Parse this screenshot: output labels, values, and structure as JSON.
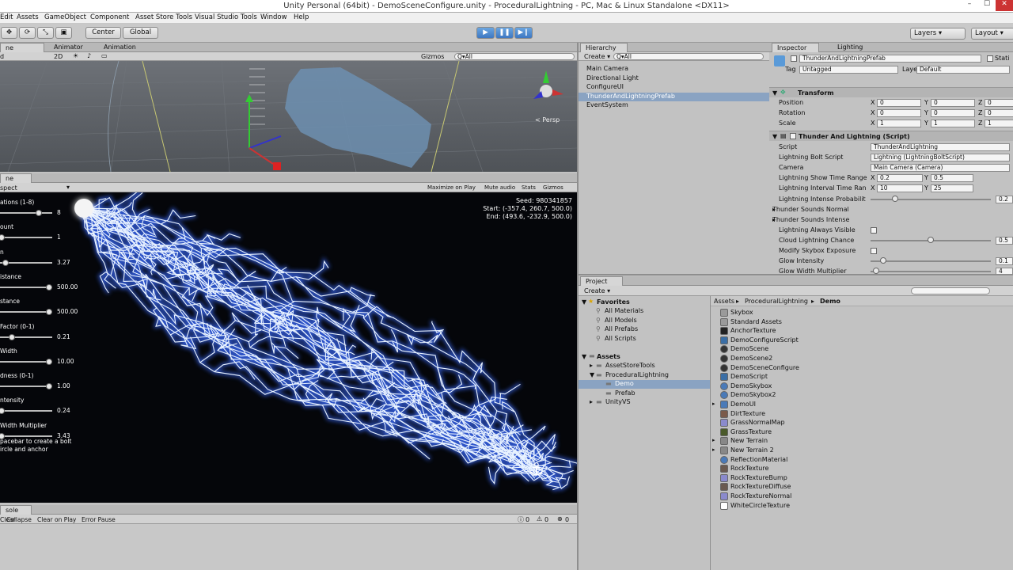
{
  "window": {
    "title": "Unity Personal (64bit) - DemoSceneConfigure.unity - ProceduralLightning - PC, Mac & Linux Standalone <DX11>",
    "min": "–",
    "max": "☐",
    "close": "✕"
  },
  "menu": [
    "Edit",
    "Assets",
    "GameObject",
    "Component",
    "Asset Store Tools",
    "Visual Studio Tools",
    "Window",
    "Help"
  ],
  "toolbar": {
    "center": "Center",
    "global": "Global",
    "layers": "Layers",
    "layout": "Layout"
  },
  "scene": {
    "tab": "ne",
    "animator": "Animator",
    "animation": "Animation",
    "mode": "d",
    "two_d": "2D",
    "gizmos": "Gizmos",
    "search": "Q▾All",
    "persp": "< Persp"
  },
  "game": {
    "tab": "ne",
    "aspect": "spect",
    "maximize": "Maximize on Play",
    "mute": "Mute audio",
    "stats": "Stats",
    "gizmos": "Gizmos",
    "seed": "Seed: 980341857",
    "start": "Start: (-357.4, 260.7, 500.0)",
    "end": "End: (493.6, -232.9, 500.0)",
    "controls": [
      {
        "label": "ations (1-8)",
        "value": "8",
        "pos": 0.78
      },
      {
        "label": "ount",
        "value": "1",
        "pos": 0.0
      },
      {
        "label": "n",
        "value": "3.27",
        "pos": 0.08
      },
      {
        "label": "istance",
        "value": "500.00",
        "pos": 1.0
      },
      {
        "label": "stance",
        "value": "500.00",
        "pos": 1.0
      },
      {
        "label": "Factor (0-1)",
        "value": "0.21",
        "pos": 0.21
      },
      {
        "label": "Width",
        "value": "10.00",
        "pos": 1.0
      },
      {
        "label": "dness (0-1)",
        "value": "1.00",
        "pos": 1.0
      },
      {
        "label": "ntensity",
        "value": "0.24",
        "pos": 0.0
      },
      {
        "label": "Width Multiplier",
        "value": "3.43",
        "pos": 0.0
      }
    ],
    "hint1": "pacebar to create a bolt",
    "hint2": "ircle and anchor"
  },
  "console": {
    "tab": "sole",
    "clear": "Clear",
    "collapse": "Collapse",
    "clear_on_play": "Clear on Play",
    "error_pause": "Error Pause",
    "c1": "0",
    "c2": "0",
    "c3": "0"
  },
  "hierarchy": {
    "tab": "Hierarchy",
    "create": "Create ▾",
    "search": "Q▾All",
    "items": [
      "Main Camera",
      "Directional Light",
      "ConfigureUI",
      "ThunderAndLightningPrefab",
      "EventSystem"
    ],
    "selected": 3
  },
  "inspector": {
    "tab": "Inspector",
    "tab2": "Lighting",
    "name": "ThunderAndLightningPrefab",
    "static": "Stati",
    "tag_label": "Tag",
    "tag": "Untagged",
    "layer_label": "Layer",
    "layer": "Default",
    "transform": "Transform",
    "position": "Position",
    "rotation": "Rotation",
    "scale": "Scale",
    "pos": [
      "0",
      "0",
      "0"
    ],
    "rot": [
      "0",
      "0",
      "0"
    ],
    "scl": [
      "1",
      "1",
      "1"
    ],
    "script_title": "Thunder And Lightning (Script)",
    "script_label": "Script",
    "script_val": "ThunderAndLightning",
    "bolt_label": "Lightning Bolt Script",
    "bolt_val": "Lightning (LightningBoltScript)",
    "camera_label": "Camera",
    "camera_val": "Main Camera (Camera)",
    "show_label": "Lightning Show Time Range",
    "show_x": "0.2",
    "show_y": "0.5",
    "interval_label": "Lightning Interval Time Ran",
    "int_x": "10",
    "int_y": "25",
    "intense_label": "Lightning Intense Probabilit",
    "intense_val": "0.2",
    "normal_label": "Thunder Sounds Normal",
    "intense2_label": "Thunder Sounds Intense",
    "visible_label": "Lightning Always Visible",
    "cloud_label": "Cloud Lightning Chance",
    "cloud_val": "0.5",
    "skybox_label": "Modify Skybox Exposure",
    "glow_label": "Glow Intensity",
    "glow_val": "0.1",
    "glowm_label": "Glow Width Multiplier",
    "glowm_val": "4",
    "x": "X",
    "y": "Y",
    "z": "Z"
  },
  "project": {
    "tab": "Project",
    "create": "Create ▾",
    "favorites": "Favorites",
    "fav_items": [
      "All Materials",
      "All Models",
      "All Prefabs",
      "All Scripts"
    ],
    "assets": "Assets",
    "tree": [
      "AssetStoreTools",
      "ProceduralLightning",
      "Demo",
      "Prefab",
      "UnityVS"
    ],
    "crumbs": [
      "Assets",
      "ProceduralLightning",
      "Demo"
    ],
    "files": [
      {
        "name": "Skybox",
        "icon": "folder-icon",
        "color": "#9a9a9a"
      },
      {
        "name": "Standard Assets",
        "icon": "folder-icon",
        "color": "#9a9a9a"
      },
      {
        "name": "AnchorTexture",
        "icon": "texture-icon",
        "color": "#222"
      },
      {
        "name": "DemoConfigureScript",
        "icon": "script-icon",
        "color": "#3a6ea5"
      },
      {
        "name": "DemoScene",
        "icon": "unity-icon",
        "color": "#333"
      },
      {
        "name": "DemoScene2",
        "icon": "unity-icon",
        "color": "#333"
      },
      {
        "name": "DemoSceneConfigure",
        "icon": "unity-icon",
        "color": "#333"
      },
      {
        "name": "DemoScript",
        "icon": "script-icon",
        "color": "#3a6ea5"
      },
      {
        "name": "DemoSkybox",
        "icon": "material-icon",
        "color": "#4a7ab8"
      },
      {
        "name": "DemoSkybox2",
        "icon": "material-icon",
        "color": "#4a7ab8"
      },
      {
        "name": "DemoUI",
        "icon": "prefab-icon",
        "color": "#4a7ab8"
      },
      {
        "name": "DirtTexture",
        "icon": "texture-icon",
        "color": "#7a5a4a"
      },
      {
        "name": "GrassNormalMap",
        "icon": "texture-icon",
        "color": "#8a8acc"
      },
      {
        "name": "GrassTexture",
        "icon": "texture-icon",
        "color": "#4a5a2a"
      },
      {
        "name": "New Terrain",
        "icon": "terrain-icon",
        "color": "#888"
      },
      {
        "name": "New Terrain 2",
        "icon": "terrain-icon",
        "color": "#888"
      },
      {
        "name": "ReflectionMaterial",
        "icon": "material-icon",
        "color": "#4a7ab8"
      },
      {
        "name": "RockTexture",
        "icon": "texture-icon",
        "color": "#6a5a50"
      },
      {
        "name": "RockTextureBump",
        "icon": "texture-icon",
        "color": "#8a8acc"
      },
      {
        "name": "RockTextureDiffuse",
        "icon": "texture-icon",
        "color": "#6a5a50"
      },
      {
        "name": "RockTextureNormal",
        "icon": "texture-icon",
        "color": "#8a8acc"
      },
      {
        "name": "WhiteCircleTexture",
        "icon": "texture-icon",
        "color": "#fff"
      }
    ]
  }
}
